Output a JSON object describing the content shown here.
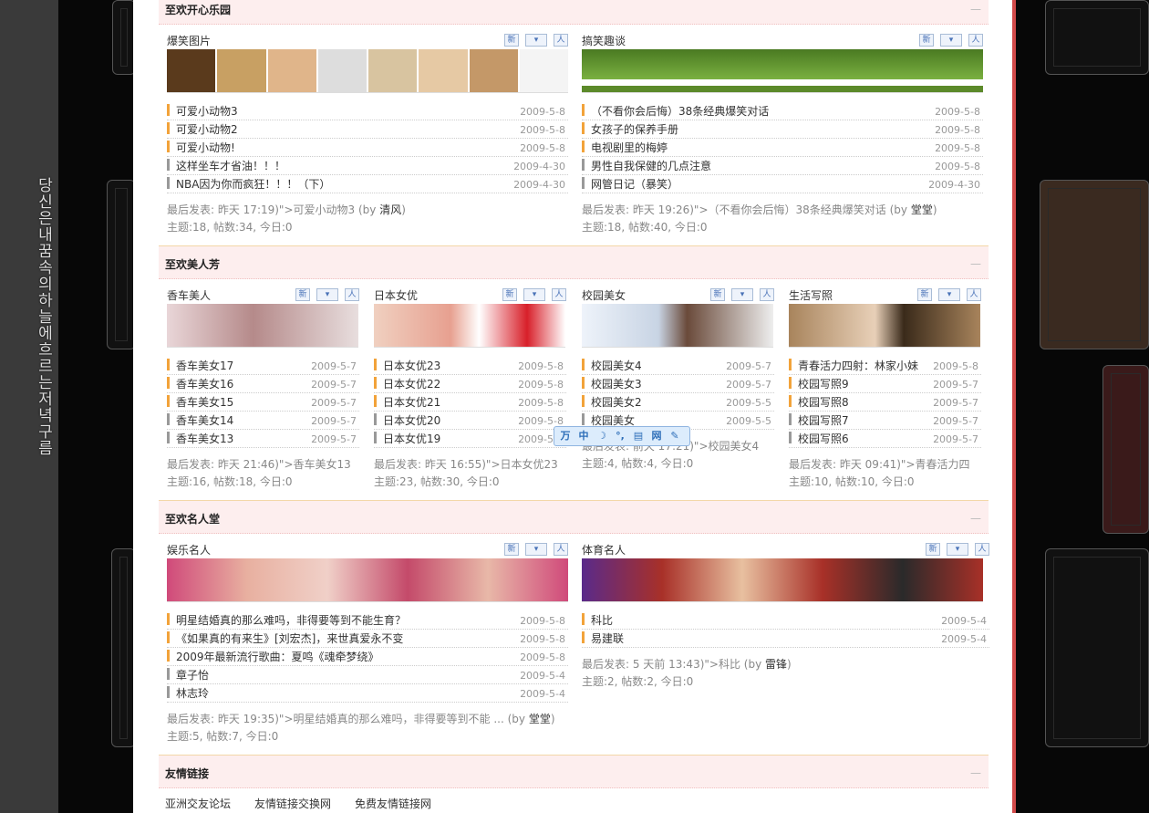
{
  "side_text": "당신은 내 꿈 속의 하늘에 흐르는 저녁구름",
  "categories": [
    {
      "title": "至欢开心乐园",
      "collapse": "—"
    },
    {
      "title": "至欢美人芳",
      "collapse": "—"
    },
    {
      "title": "至欢名人堂",
      "collapse": "—"
    },
    {
      "title": "友情链接",
      "collapse": "—"
    }
  ],
  "btn_labels": {
    "new": "新",
    "opt": "▾",
    "user": "人"
  },
  "forums": {
    "f1": {
      "name": "爆笑图片",
      "banner_color": "#c8a063",
      "threads": [
        {
          "t": "可爱小动物3",
          "d": "2009-5-8"
        },
        {
          "t": "可爱小动物2",
          "d": "2009-5-8"
        },
        {
          "t": "可爱小动物!",
          "d": "2009-5-8"
        },
        {
          "t": "这样坐车才省油！！！",
          "d": "2009-4-30"
        },
        {
          "t": "NBA因为你而疯狂！！！（下）",
          "d": "2009-4-30"
        }
      ],
      "last": "最后发表: 昨天 17:19)\">可爱小动物3 (by ",
      "last_user": "清风",
      "last_end": ")",
      "stats": "主题:18, 帖数:34, 今日:0"
    },
    "f2": {
      "name": "搞笑趣谈",
      "banner_color": "#5c8a2a",
      "threads": [
        {
          "t": "（不看你会后悔）38条经典爆笑对话",
          "d": "2009-5-8"
        },
        {
          "t": "女孩子的保养手册",
          "d": "2009-5-8"
        },
        {
          "t": "电视剧里的梅婷",
          "d": "2009-5-8"
        },
        {
          "t": "男性自我保健的几点注意",
          "d": "2009-5-8"
        },
        {
          "t": "网管日记（暴笑）",
          "d": "2009-4-30"
        }
      ],
      "last": "最后发表: 昨天 19:26)\">（不看你会后悔）38条经典爆笑对话 (by ",
      "last_user": "堂堂",
      "last_end": ")",
      "stats": "主题:18, 帖数:40, 今日:0"
    },
    "f3": {
      "name": "香车美人",
      "banner_color": "#c9a6a8",
      "threads": [
        {
          "t": "香车美女17",
          "d": "2009-5-7"
        },
        {
          "t": "香车美女16",
          "d": "2009-5-7"
        },
        {
          "t": "香车美女15",
          "d": "2009-5-7"
        },
        {
          "t": "香车美女14",
          "d": "2009-5-7"
        },
        {
          "t": "香车美女13",
          "d": "2009-5-7"
        }
      ],
      "last": "最后发表: 昨天 21:46)\">香车美女13",
      "stats": "主题:16, 帖数:18, 今日:0"
    },
    "f4": {
      "name": "日本女优",
      "banner_color": "#e7a090",
      "threads": [
        {
          "t": "日本女优23",
          "d": "2009-5-8"
        },
        {
          "t": "日本女优22",
          "d": "2009-5-8"
        },
        {
          "t": "日本女优21",
          "d": "2009-5-8"
        },
        {
          "t": "日本女优20",
          "d": "2009-5-8"
        },
        {
          "t": "日本女优19",
          "d": "2009-5-8"
        }
      ],
      "last": "最后发表: 昨天 16:55)\">日本女优23",
      "stats": "主题:23, 帖数:30, 今日:0"
    },
    "f5": {
      "name": "校园美女",
      "banner_color": "#c8d4e4",
      "threads": [
        {
          "t": "校园美女4",
          "d": "2009-5-7"
        },
        {
          "t": "校园美女3",
          "d": "2009-5-7"
        },
        {
          "t": "校园美女2",
          "d": "2009-5-5"
        },
        {
          "t": "校园美女",
          "d": "2009-5-5"
        }
      ],
      "last": "最后发表: 前天 17:21)\">校园美女4",
      "stats": "主题:4, 帖数:4, 今日:0"
    },
    "f6": {
      "name": "生活写照",
      "banner_color": "#a8845c",
      "threads": [
        {
          "t": "青春活力四射：林家小妹",
          "d": "2009-5-8"
        },
        {
          "t": "校园写照9",
          "d": "2009-5-7"
        },
        {
          "t": "校园写照8",
          "d": "2009-5-7"
        },
        {
          "t": "校园写照7",
          "d": "2009-5-7"
        },
        {
          "t": "校园写照6",
          "d": "2009-5-7"
        }
      ],
      "last": "最后发表: 昨天 09:41)\">青春活力四",
      "stats": "主题:10, 帖数:10, 今日:0"
    },
    "f7": {
      "name": "娱乐名人",
      "banner_color": "#d04a7a",
      "threads": [
        {
          "t": "明星结婚真的那么难吗，非得要等到不能生育？",
          "d": "2009-5-8"
        },
        {
          "t": "《如果真的有来生》[刘宏杰]，来世真爱永不变",
          "d": "2009-5-8"
        },
        {
          "t": "2009年最新流行歌曲：夏鸣《魂牵梦绕》",
          "d": "2009-5-8"
        },
        {
          "t": "章子怡",
          "d": "2009-5-4"
        },
        {
          "t": "林志玲",
          "d": "2009-5-4"
        }
      ],
      "last": "最后发表: 昨天 19:35)\">明星结婚真的那么难吗，非得要等到不能 ... (by ",
      "last_user": "堂堂",
      "last_end": ")",
      "stats": "主题:5, 帖数:7, 今日:0"
    },
    "f8": {
      "name": "体育名人",
      "banner_color": "#a83028",
      "threads": [
        {
          "t": "科比",
          "d": "2009-5-4"
        },
        {
          "t": "易建联",
          "d": "2009-5-4"
        }
      ],
      "last": "最后发表: 5 天前 13:43)\">科比 (by ",
      "last_user": "雷锋",
      "last_end": ")",
      "stats": "主题:2, 帖数:2, 今日:0"
    }
  },
  "ime": {
    "b1": "万",
    "b2": "中",
    "b3": "☽",
    "b4": "°,",
    "b5": "▤",
    "b6": "网",
    "b7": "✎"
  },
  "links": [
    "亚洲交友论坛",
    "友情链接交换网",
    "免费友情链接网"
  ]
}
